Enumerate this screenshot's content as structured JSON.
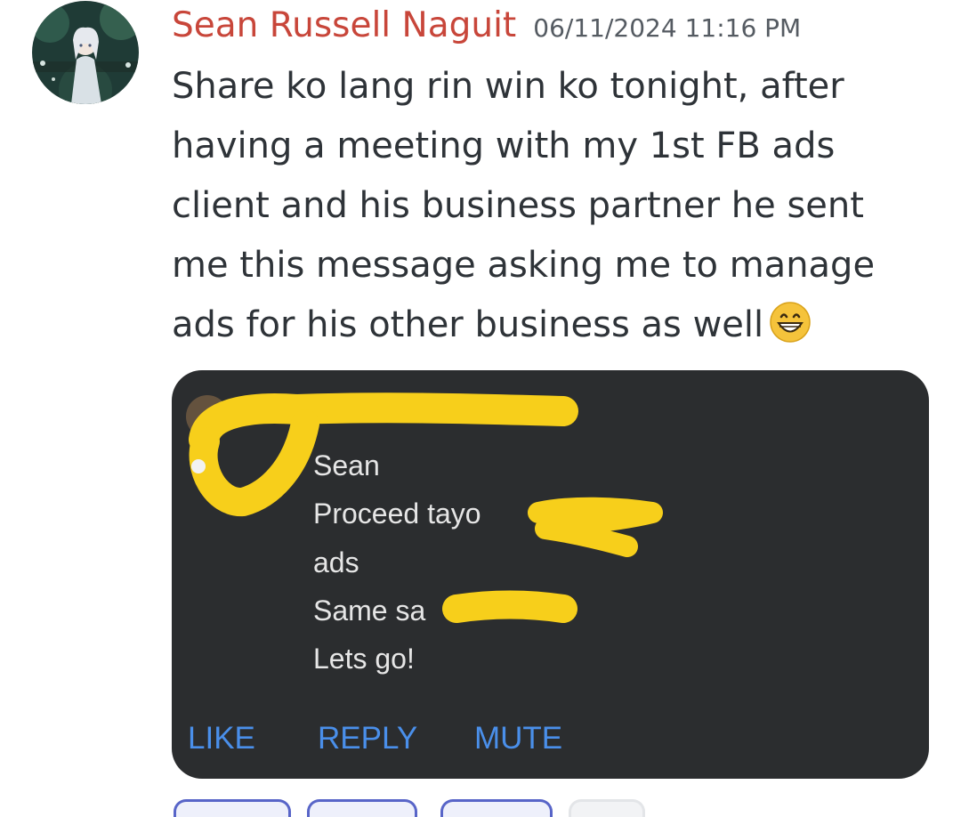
{
  "message": {
    "author": "Sean Russell Naguit",
    "timestamp": "06/11/2024 11:16 PM",
    "lines": [
      "Share ko lang rin win ko tonight, after",
      "having a meeting with my 1st FB ads",
      "client and his business partner he sent",
      "me this message asking me to manage",
      "ads for his other business as well"
    ],
    "emoji": "grinning-face-with-smiling-eyes",
    "avatar_icon": "anime-character-avatar"
  },
  "attachment": {
    "notification_lines": [
      "Sean",
      "Proceed tayo",
      "ads",
      "Same sa",
      "Lets go!"
    ],
    "actions": [
      "LIKE",
      "REPLY",
      "MUTE"
    ],
    "redaction_color": "#f7cf1b",
    "background_color": "#2b2d2f",
    "action_color": "#4a8fea"
  },
  "colors": {
    "author": "#c8463a",
    "timestamp": "#555b62",
    "message_text": "#2e3338",
    "reaction_border": "#5865c8"
  }
}
